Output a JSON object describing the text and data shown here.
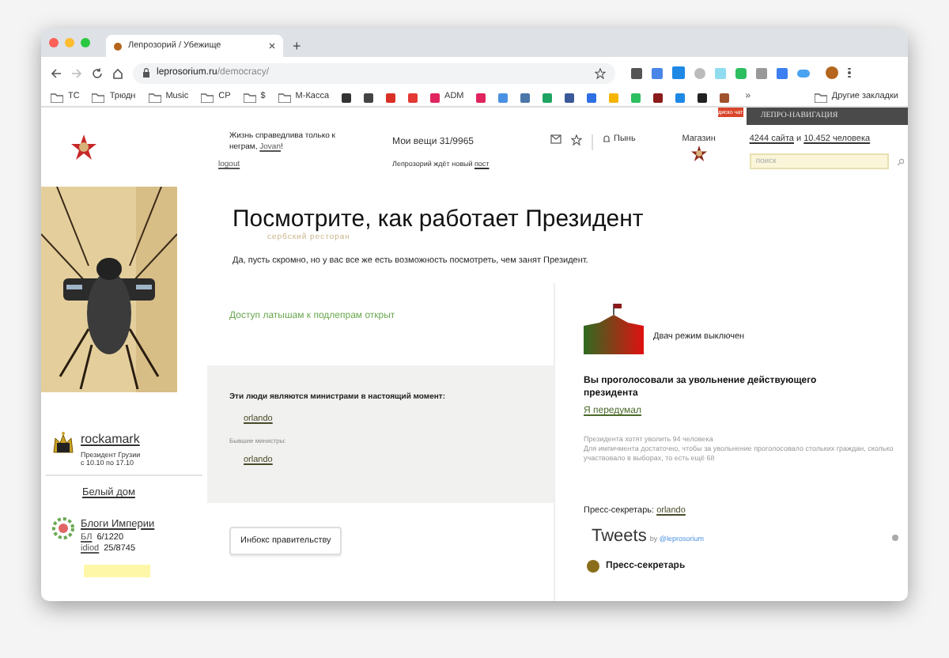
{
  "browser": {
    "tab_title": "Лепрозорий / Убежище",
    "new_tab": "+",
    "url_domain": "leprosorium.ru",
    "url_path": "/democracy/"
  },
  "bookmarks": [
    {
      "kind": "folder",
      "label": "ТС"
    },
    {
      "kind": "folder",
      "label": "Трюдн"
    },
    {
      "kind": "folder",
      "label": "Music"
    },
    {
      "kind": "folder",
      "label": "СР"
    },
    {
      "kind": "folder",
      "label": "$"
    },
    {
      "kind": "folder",
      "label": "M-Касса"
    },
    {
      "kind": "site",
      "color": "#333333"
    },
    {
      "kind": "site",
      "color": "#444444"
    },
    {
      "kind": "site",
      "color": "#d93025"
    },
    {
      "kind": "site",
      "color": "#e53935"
    },
    {
      "kind": "site",
      "color": "#e0245e",
      "label": "ADM"
    },
    {
      "kind": "site",
      "color": "#e0245e"
    },
    {
      "kind": "site",
      "color": "#4a90e2"
    },
    {
      "kind": "site",
      "color": "#4a76a8"
    },
    {
      "kind": "site",
      "color": "#1fa463"
    },
    {
      "kind": "site",
      "color": "#3b5998"
    },
    {
      "kind": "site",
      "color": "#2f6fe4"
    },
    {
      "kind": "site",
      "color": "#f4b400"
    },
    {
      "kind": "site",
      "color": "#2dbe60"
    },
    {
      "kind": "site",
      "color": "#8b1a1a"
    },
    {
      "kind": "site",
      "color": "#1e88e5"
    },
    {
      "kind": "site",
      "color": "#222222"
    },
    {
      "kind": "site",
      "color": "#a0522d"
    }
  ],
  "more_bookmarks": "»",
  "other_bookmarks": "Другие закладки",
  "header": {
    "greeting": "Жизнь справедлива только к неграм, ",
    "user": "Jovan",
    "greeting_end": "!",
    "logout": "logout",
    "my_things": "Мои вещи 31/9965",
    "news": "Лепрозорий ждёт новый ",
    "news_link": "пост",
    "pyn": "Пынь",
    "shop": "Магазин",
    "chat_badge": "диско чат",
    "nav_title": "ЛЕПРО-НАВИГАЦИЯ",
    "sites": "4244 сайта",
    "and": " и ",
    "people": "10.452 человека",
    "search_placeholder": "поиск"
  },
  "sidebar": {
    "president": {
      "name": "rockamark",
      "role": "Президент Грузии",
      "term": "с 10.10 по 17.10"
    },
    "white_house": "Белый дом",
    "blogs": {
      "title": "Блоги Империи",
      "rows": [
        {
          "tag": "БЛ",
          "count": "6/1220"
        },
        {
          "tag": "idiod",
          "count": "25/8745"
        }
      ]
    }
  },
  "main": {
    "title": "Посмотрите, как работает Президент",
    "subtitle": "сербский ресторан",
    "intro": "Да, пусть скромно, но у вас все же есть возможность посмотреть, чем занят Президент.",
    "access_notice": "Доступ латышам к подлепрам открыт",
    "ministers": {
      "heading": "Эти люди являются министрами в настоящий момент:",
      "current": [
        "orlando"
      ],
      "former_label": "Бывшие министры:",
      "former": [
        "orlando"
      ]
    },
    "inbox_button": "Инбокс правительству"
  },
  "right": {
    "dvach": "Двач режим выключен",
    "vote_title": "Вы проголосовали за увольнение действующего президента",
    "undo": "Я передумал",
    "stats": [
      "Президента хотят уволить 94 человека",
      "Для импичмента достаточно, чтобы за увольнение проголосовало стольких граждан, сколько участвовало в выборах, то есть ещё 68"
    ],
    "press_label": "Пресс-секретарь: ",
    "press_name": "orlando",
    "tweets_title": "Tweets",
    "tweets_by": "by ",
    "tweets_handle": "@leprosorium",
    "tweet_author": "Пресс-секретарь"
  }
}
